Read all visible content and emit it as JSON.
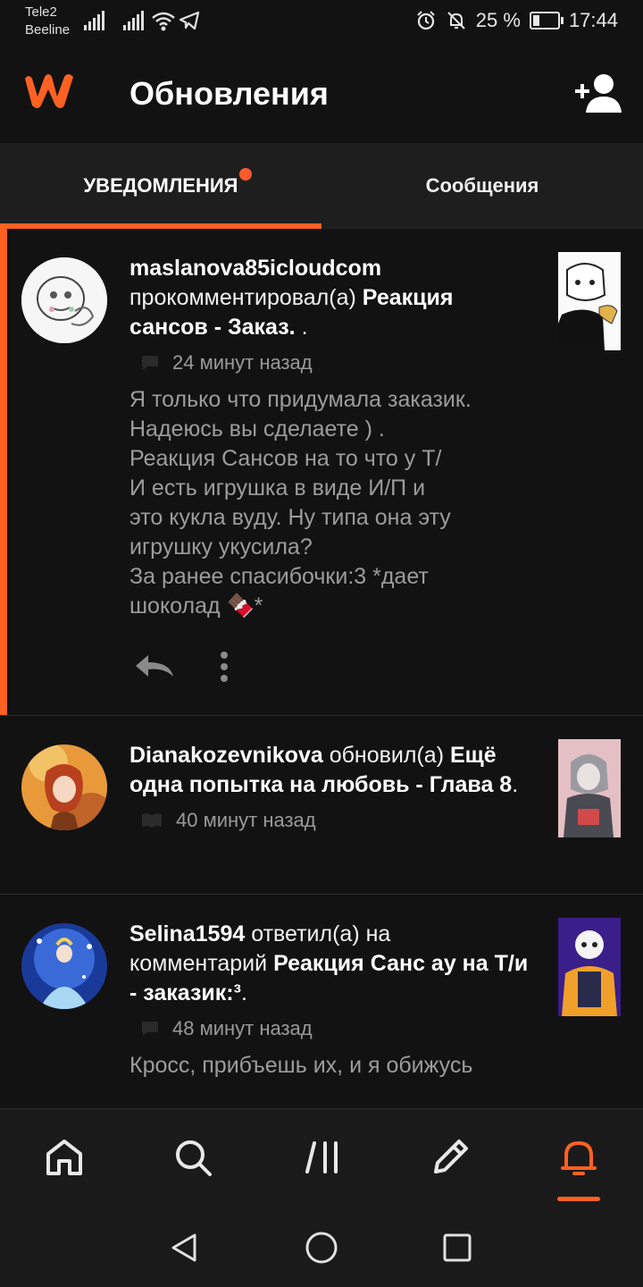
{
  "status_bar": {
    "carrier1": "Tele2",
    "carrier2": "Beeline",
    "battery": "25 %",
    "time": "17:44"
  },
  "header": {
    "title": "Обновления",
    "logo_icon": "wattpad-logo",
    "add_user_icon": "add-user-icon"
  },
  "tabs": [
    {
      "label": "УВЕДОМЛЕНИЯ",
      "active": true,
      "has_badge": true
    },
    {
      "label": "Сообщения",
      "active": false
    }
  ],
  "notifications": [
    {
      "user": "maslanova85icloudcom",
      "action": " прокомментировал(а) ",
      "target": "Реакция сансов - Заказ.",
      "suffix": " .",
      "time_icon": "comment-icon",
      "time": "24 минут назад",
      "text_lines": [
        "Я только что придумала заказик.",
        "Надеюсь вы сделаете ) .",
        "Реакция Сансов на то что у Т/",
        "И есть игрушка в виде И/П и",
        "это кукла вуду. Ну типа она эту",
        "игрушку укусила?",
        "За ранее спасибочки:3 *дает",
        "шоколад 🍫*"
      ],
      "unread": true
    },
    {
      "user": "Dianakozevnikova",
      "action": " обновил(а) ",
      "target": "Ещё одна попытка на любовь - Глава 8",
      "suffix": ".",
      "time_icon": "book-icon",
      "time": "40 минут назад",
      "unread": false
    },
    {
      "user": "Selina1594",
      "action": " ответил(а) на комментарий ",
      "target": "Реакция Санс ау на Т/и - заказик:³",
      "suffix": ".",
      "time_icon": "comment-icon",
      "time": "48 минут назад",
      "text": "Кросс, прибъешь их, и я обижусь",
      "unread": false
    }
  ],
  "bottom_nav": [
    "home-icon",
    "search-icon",
    "library-icon",
    "write-icon",
    "notifications-icon"
  ],
  "system_nav": [
    "back-icon",
    "home-circle-icon",
    "recents-icon"
  ],
  "colors": {
    "accent": "#ff6122",
    "background": "#121212"
  }
}
